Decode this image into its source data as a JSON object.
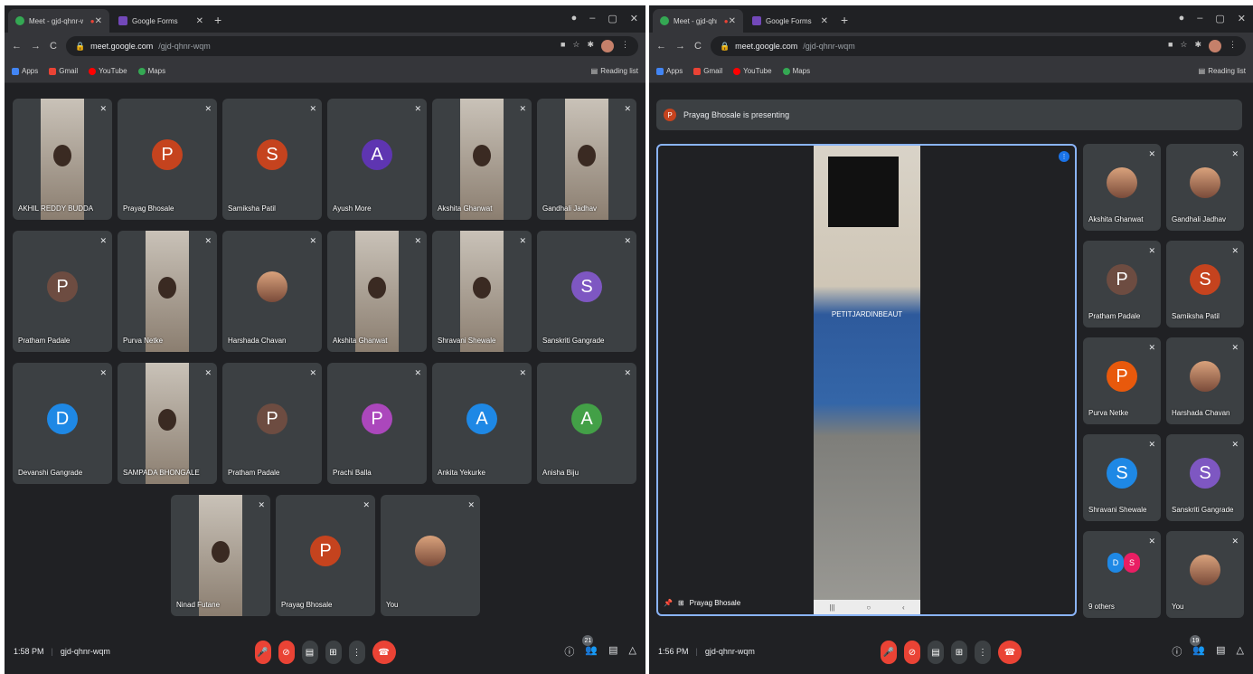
{
  "left": {
    "tabs": [
      {
        "label": "Meet - gjd-qhnr-wqm",
        "active": true
      },
      {
        "label": "Google Forms",
        "active": false
      }
    ],
    "url": {
      "host": "meet.google.com",
      "path": "/gjd-qhnr-wqm"
    },
    "bookmarks": [
      "Apps",
      "Gmail",
      "YouTube",
      "Maps"
    ],
    "reading_list": "Reading list",
    "participants": [
      {
        "name": "AKHIL REDDY BUDDA",
        "type": "video"
      },
      {
        "name": "Prayag Bhosale",
        "initial": "P",
        "color": "#c5431e"
      },
      {
        "name": "Samiksha Patil",
        "initial": "S",
        "color": "#c5431e"
      },
      {
        "name": "Ayush More",
        "initial": "A",
        "color": "#5e35b1"
      },
      {
        "name": "Akshita Ghanwat",
        "type": "video"
      },
      {
        "name": "Gandhali Jadhav",
        "type": "video"
      },
      {
        "name": "Pratham Padale",
        "initial": "P",
        "color": "#6d4c41"
      },
      {
        "name": "Purva Netke",
        "type": "video"
      },
      {
        "name": "Harshada Chavan",
        "type": "photo"
      },
      {
        "name": "Akshita Ghanwat",
        "type": "video"
      },
      {
        "name": "Shravani Shewale",
        "type": "video"
      },
      {
        "name": "Sanskriti Gangrade",
        "initial": "S",
        "color": "#7e57c2"
      },
      {
        "name": "Devanshi Gangrade",
        "initial": "D",
        "color": "#1e88e5"
      },
      {
        "name": "SAMPADA BHONGALE",
        "type": "video"
      },
      {
        "name": "Pratham Padale",
        "initial": "P",
        "color": "#6d4c41"
      },
      {
        "name": "Prachi Balla",
        "initial": "P",
        "color": "#ab47bc"
      },
      {
        "name": "Ankita Yekurke",
        "initial": "A",
        "color": "#1e88e5"
      },
      {
        "name": "Anisha Biju",
        "initial": "A",
        "color": "#43a047"
      },
      {
        "name": "Ninad Futane",
        "type": "video"
      },
      {
        "name": "Prayag Bhosale",
        "initial": "P",
        "color": "#c5431e"
      },
      {
        "name": "You",
        "type": "photo"
      }
    ],
    "time": "1:58 PM",
    "meeting_code": "gjd-qhnr-wqm",
    "people_count": "21"
  },
  "right": {
    "tabs": [
      {
        "label": "Meet - gjd-qhnr-wqm",
        "active": true
      },
      {
        "label": "Google Forms",
        "active": false
      }
    ],
    "url": {
      "host": "meet.google.com",
      "path": "/gjd-qhnr-wqm"
    },
    "bookmarks": [
      "Apps",
      "Gmail",
      "YouTube",
      "Maps"
    ],
    "reading_list": "Reading list",
    "presenting_initial": "P",
    "presenting_text": "Prayag Bhosale is presenting",
    "screen_sign": "PETITJARDINBEAUT",
    "presenter_label": "Prayag Bhosale",
    "sidebar": [
      {
        "name": "Akshita Ghanwat",
        "type": "photo"
      },
      {
        "name": "Gandhali Jadhav",
        "type": "photo"
      },
      {
        "name": "Pratham Padale",
        "initial": "P",
        "color": "#6d4c41"
      },
      {
        "name": "Samiksha Patil",
        "initial": "S",
        "color": "#c5431e"
      },
      {
        "name": "Purva Netke",
        "initial": "P",
        "color": "#e8590c"
      },
      {
        "name": "Harshada Chavan",
        "type": "photo"
      },
      {
        "name": "Shravani Shewale",
        "initial": "S",
        "color": "#1e88e5"
      },
      {
        "name": "Sanskriti Gangrade",
        "initial": "S",
        "color": "#7e57c2"
      },
      {
        "name": "9 others",
        "others": [
          "D",
          "S"
        ]
      },
      {
        "name": "You",
        "type": "photo"
      }
    ],
    "time": "1:56 PM",
    "meeting_code": "gjd-qhnr-wqm",
    "people_count": "19"
  },
  "colors": {
    "bg": "#202124",
    "tile": "#3c4043",
    "end_call": "#ea4335",
    "stage_border": "#8ab4f8"
  }
}
